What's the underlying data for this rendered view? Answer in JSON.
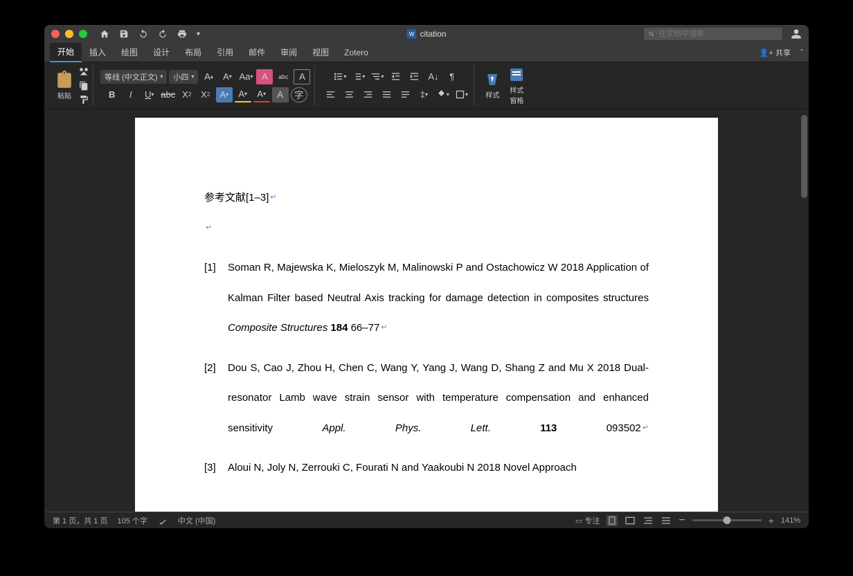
{
  "title": "citation",
  "searchPlaceholder": "在文档中搜索",
  "tabs": {
    "home": "开始",
    "insert": "插入",
    "draw": "绘图",
    "design": "设计",
    "layout": "布局",
    "references": "引用",
    "mail": "邮件",
    "review": "审阅",
    "view": "视图",
    "zotero": "Zotero"
  },
  "share": "共享",
  "paste": "粘贴",
  "fontName": "等线 (中文正文)",
  "fontSize": "小四",
  "styles": "样式",
  "stylesPane": "样式\n窗格",
  "doc": {
    "heading": "参考文献[1–3]",
    "refs": [
      {
        "num": "[1]",
        "text": "Soman R, Majewska K, Mieloszyk M, Malinowski P and Ostachowicz W 2018 Application of Kalman Filter based Neutral Axis tracking for damage detection in composites structures ",
        "ital": "Composite Structures ",
        "bold": "184",
        "tail": " 66–77"
      },
      {
        "num": "[2]",
        "text": "Dou S, Cao J, Zhou H, Chen C, Wang Y, Yang J, Wang D, Shang Z and Mu X 2018 Dual-resonator Lamb wave strain sensor with temperature compensation and enhanced sensitivity ",
        "ital": "Appl. Phys. Lett. ",
        "bold": "113",
        "tail": " 093502"
      },
      {
        "num": "[3]",
        "text": "Aloui N, Joly N, Zerrouki C, Fourati N and Yaakoubi N 2018 Novel Approach",
        "ital": "",
        "bold": "",
        "tail": ""
      }
    ]
  },
  "status": {
    "page": "第 1 页，共 1 页",
    "words": "105 个字",
    "lang": "中文 (中国)",
    "focus": "专注",
    "zoom": "141%"
  }
}
